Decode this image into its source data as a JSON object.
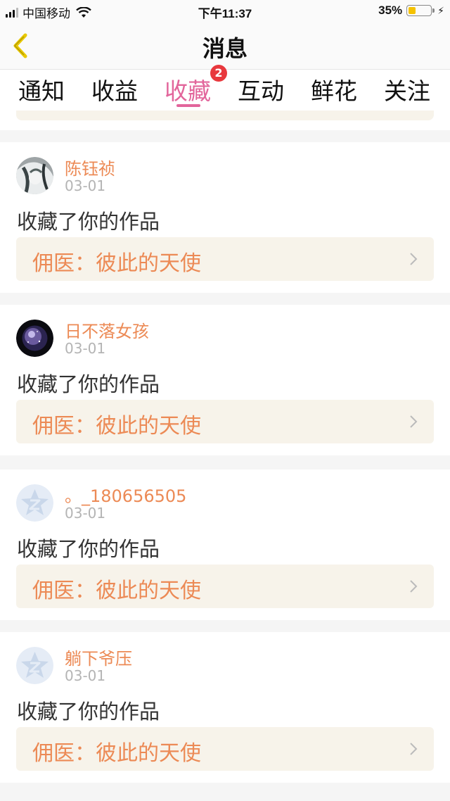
{
  "status_bar": {
    "carrier": "中国移动",
    "time": "下午11:37",
    "battery_text": "35%",
    "battery_level": 0.35
  },
  "nav": {
    "title": "消息"
  },
  "tabs": [
    {
      "label": "通知",
      "active": false
    },
    {
      "label": "收益",
      "active": false
    },
    {
      "label": "收藏",
      "active": true,
      "badge": "2"
    },
    {
      "label": "互动",
      "active": false
    },
    {
      "label": "鲜花",
      "active": false
    },
    {
      "label": "关注",
      "active": false
    }
  ],
  "notifications": [
    {
      "username": "陈钰祯",
      "date": "03-01",
      "action": "收藏了你的作品",
      "work_title": "佣医：彼此的天使",
      "avatar": "anime-character-avatar"
    },
    {
      "username": "日不落女孩",
      "date": "03-01",
      "action": "收藏了你的作品",
      "work_title": "佣医：彼此的天使",
      "avatar": "starry-orb-avatar"
    },
    {
      "username": "。_180656505",
      "date": "03-01",
      "action": "收藏了你的作品",
      "work_title": "佣医：彼此的天使",
      "avatar": "default-qq-avatar"
    },
    {
      "username": "躺下爷压",
      "date": "03-01",
      "action": "收藏了你的作品",
      "work_title": "佣医：彼此的天使",
      "avatar": "default-qq-avatar"
    }
  ],
  "colors": {
    "accent_pink": "#e2659b",
    "username_orange": "#ec8a55",
    "link_bg": "#f7f3ea",
    "badge_red": "#e8383d"
  }
}
